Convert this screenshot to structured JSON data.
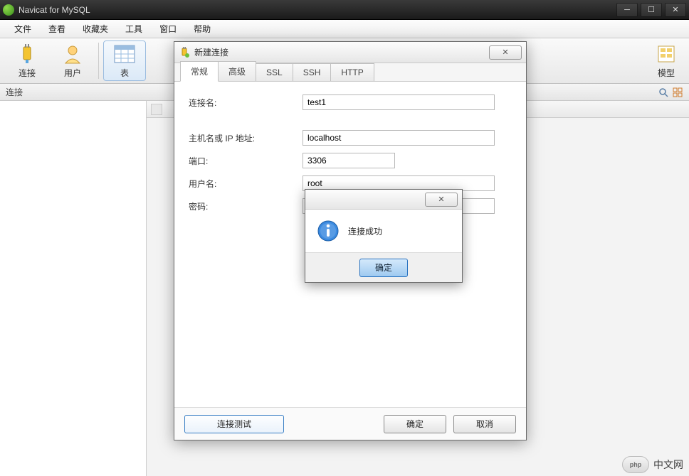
{
  "titlebar": {
    "app_title": "Navicat for MySQL"
  },
  "menu": {
    "file": "文件",
    "view": "查看",
    "favorites": "收藏夹",
    "tools": "工具",
    "window": "窗口",
    "help": "帮助"
  },
  "toolbar": {
    "connect": "连接",
    "user": "用户",
    "table": "表",
    "model": "模型"
  },
  "connrow": {
    "label": "连接"
  },
  "dialog": {
    "title": "新建连接",
    "tabs": {
      "general": "常规",
      "advanced": "高级",
      "ssl": "SSL",
      "ssh": "SSH",
      "http": "HTTP"
    },
    "labels": {
      "conn_name": "连接名:",
      "host": "主机名或 IP 地址:",
      "port": "端口:",
      "username": "用户名:",
      "password": "密码:"
    },
    "values": {
      "conn_name": "test1",
      "host": "localhost",
      "port": "3306",
      "username": "root",
      "password": ""
    },
    "buttons": {
      "test": "连接测试",
      "ok": "确定",
      "cancel": "取消"
    }
  },
  "msgbox": {
    "text": "连接成功",
    "ok": "确定"
  },
  "watermark": {
    "logo": "php",
    "text": "中文网"
  }
}
